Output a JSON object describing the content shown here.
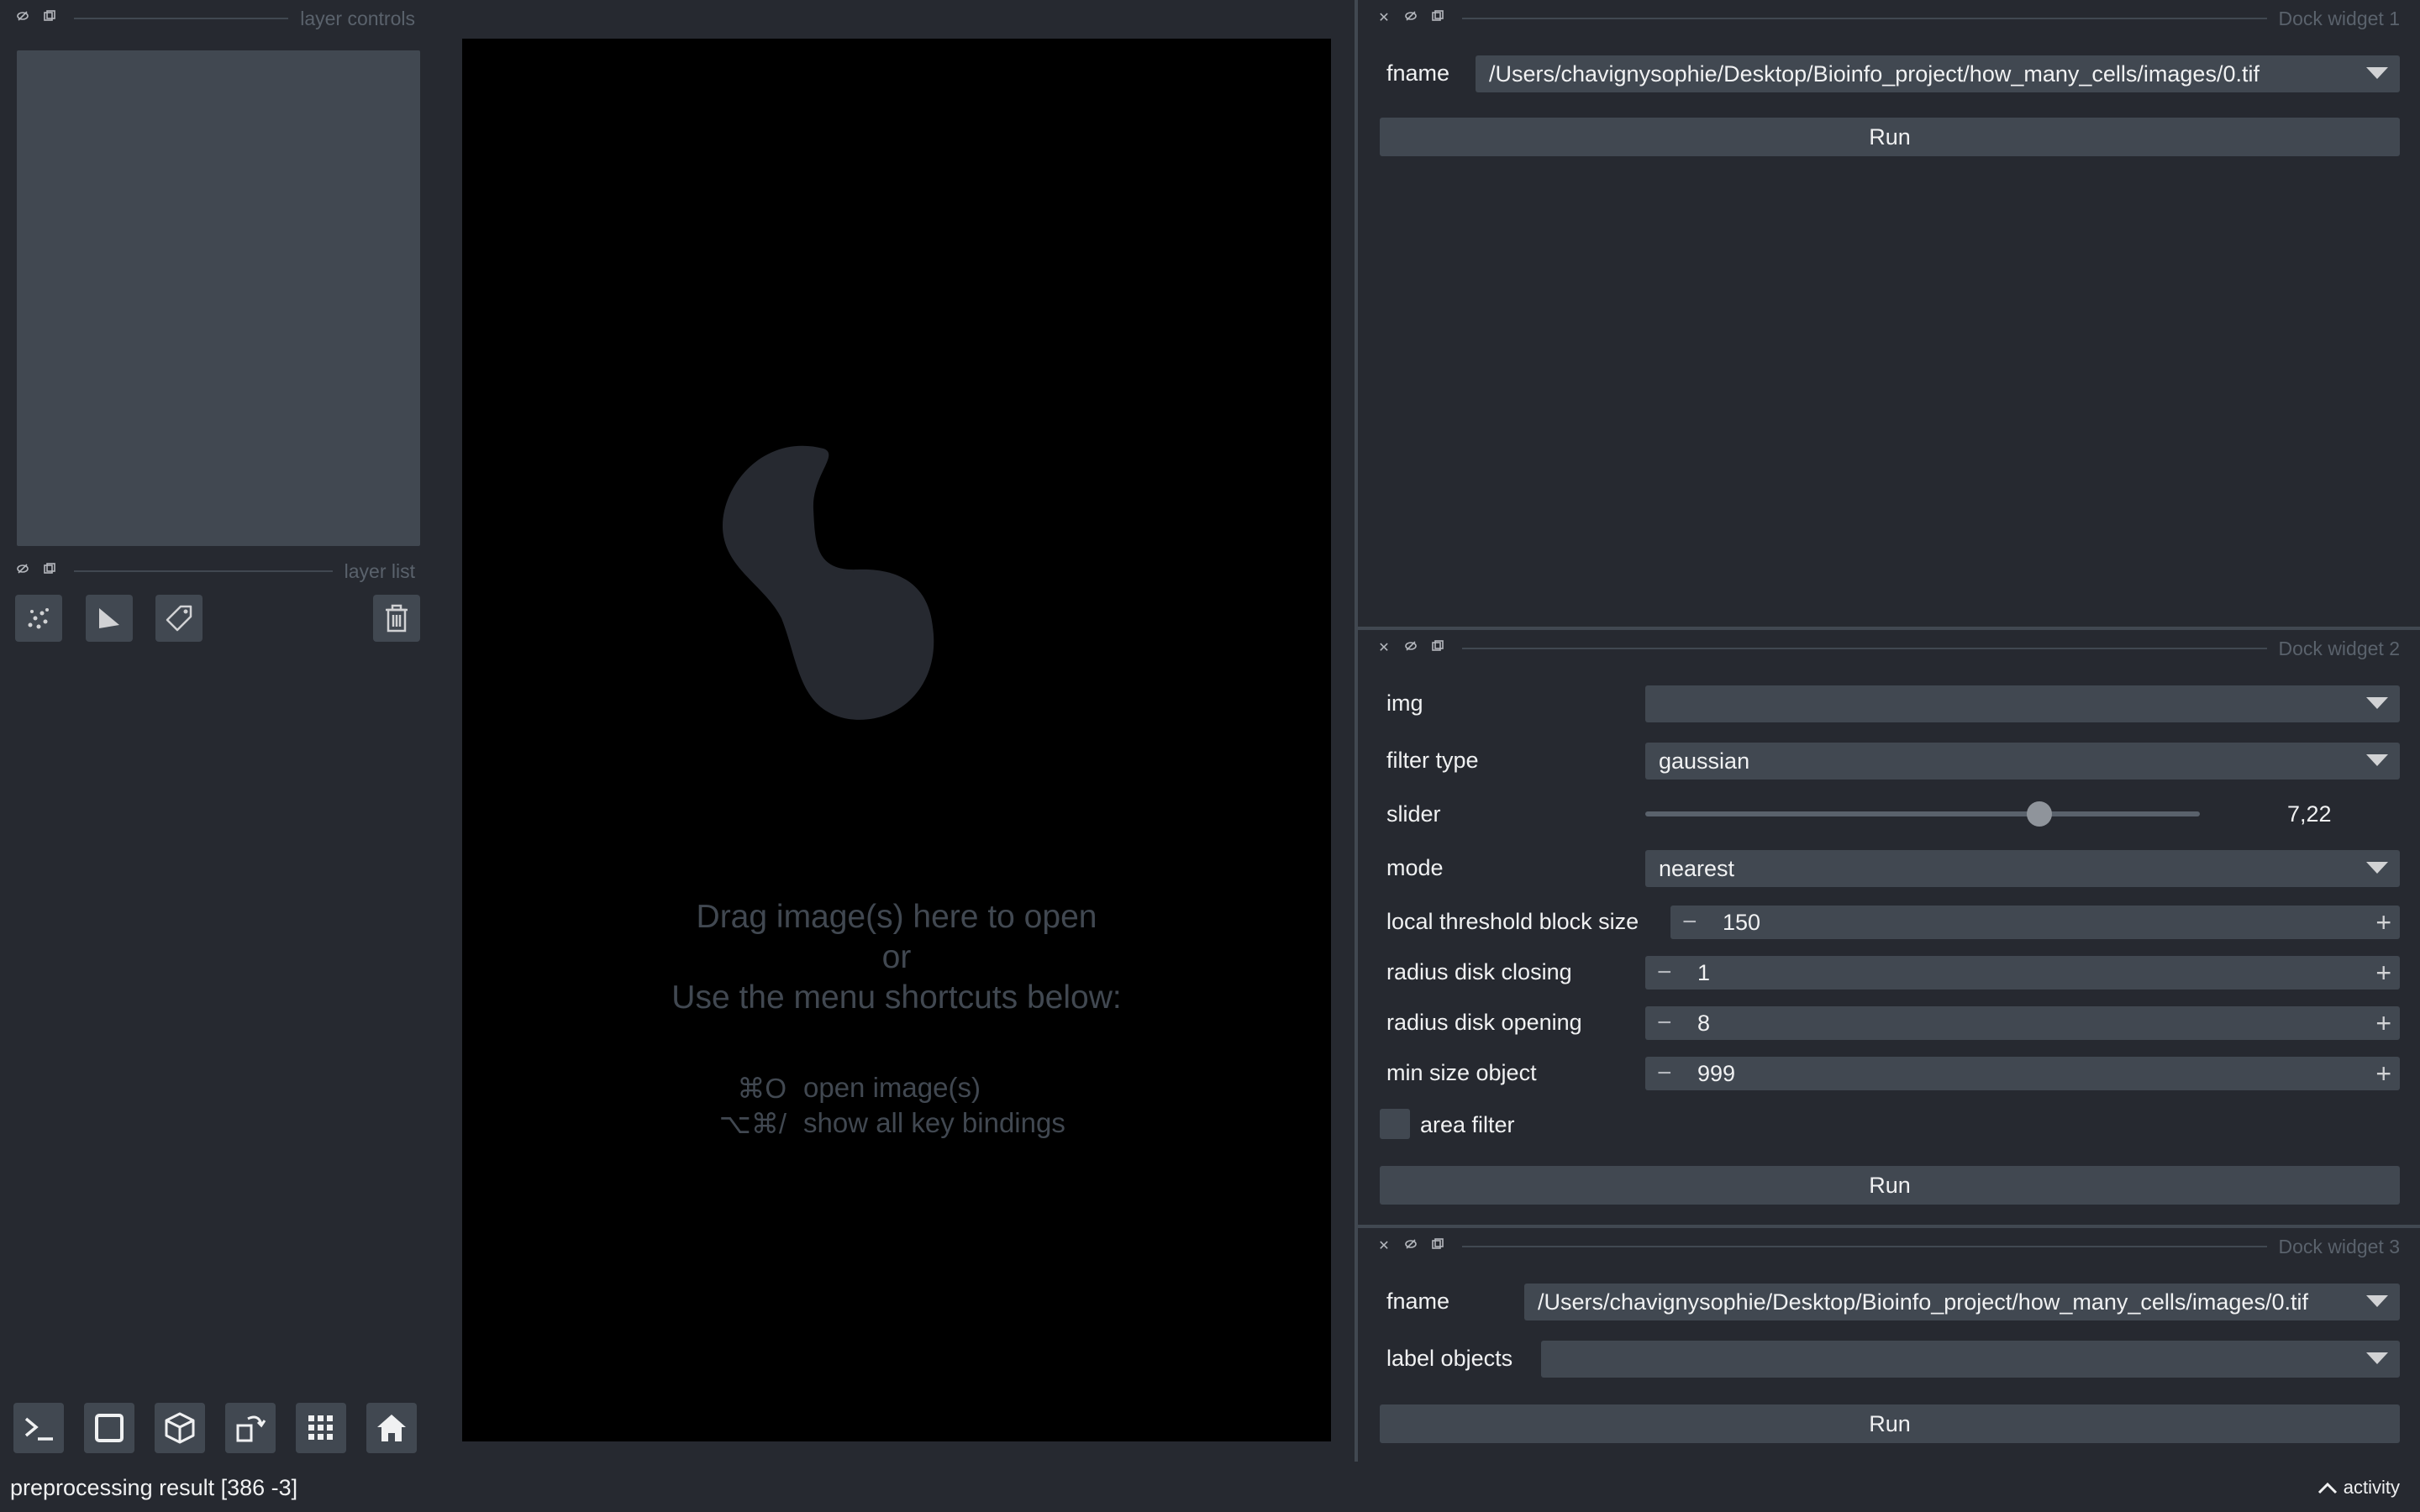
{
  "colors": {
    "background": "#262930",
    "panel": "#414851",
    "canvas": "#000000",
    "text": "#f0f1f2",
    "muted": "#5a626c"
  },
  "left": {
    "layer_controls_title": "layer controls",
    "layer_list_title": "layer list",
    "tools": [
      {
        "icon": "points-layer-icon"
      },
      {
        "icon": "shapes-layer-icon"
      },
      {
        "icon": "labels-layer-icon"
      },
      {
        "icon": "delete-layer-icon"
      }
    ],
    "bottom_buttons": [
      {
        "icon": "console-icon"
      },
      {
        "icon": "square-icon"
      },
      {
        "icon": "3d-cube-icon"
      },
      {
        "icon": "roll-dims-icon"
      },
      {
        "icon": "grid-icon"
      },
      {
        "icon": "home-icon"
      }
    ]
  },
  "canvas": {
    "welcome_line1": "Drag image(s) here to open",
    "welcome_line2": "or",
    "welcome_line3": "Use the menu shortcuts below:",
    "shortcut1_key": "⌘O",
    "shortcut1_label": "open image(s)",
    "shortcut2_key": "⌥⌘/",
    "shortcut2_label": "show all key bindings"
  },
  "dock1": {
    "title": "Dock widget 1",
    "fname_label": "fname",
    "fname_value": "/Users/chavignysophie/Desktop/Bioinfo_project/how_many_cells/images/0.tif",
    "run_label": "Run"
  },
  "dock2": {
    "title": "Dock widget 2",
    "img_label": "img",
    "img_value": "",
    "filter_type_label": "filter type",
    "filter_type_value": "gaussian",
    "slider_label": "slider",
    "slider_value": "7,22",
    "slider_fraction": 0.71,
    "mode_label": "mode",
    "mode_value": "nearest",
    "block_size_label": "local threshold block size",
    "block_size_value": "150",
    "closing_label": "radius disk closing",
    "closing_value": "1",
    "opening_label": "radius disk opening",
    "opening_value": "8",
    "min_size_label": "min size object",
    "min_size_value": "999",
    "area_filter_label": "area filter",
    "area_filter_checked": false,
    "run_label": "Run"
  },
  "dock3": {
    "title": "Dock widget 3",
    "fname_label": "fname",
    "fname_value": "/Users/chavignysophie/Desktop/Bioinfo_project/how_many_cells/images/0.tif",
    "label_objects_label": "label objects",
    "label_objects_value": "",
    "run_label": "Run"
  },
  "status": {
    "text": "preprocessing result [386  -3]",
    "activity_label": "activity"
  }
}
